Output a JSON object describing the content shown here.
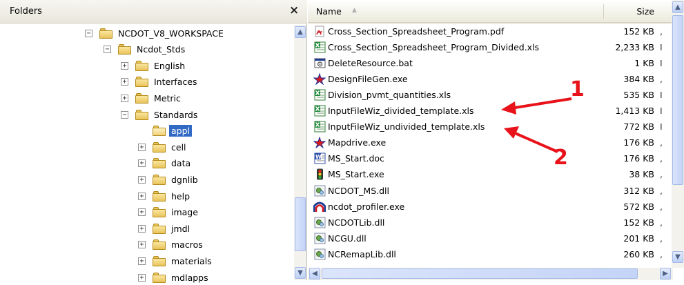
{
  "folders": {
    "title": "Folders",
    "close_glyph": "×",
    "tree": [
      {
        "label": "NCDOT_V8_WORKSPACE",
        "expander": "−",
        "icon": "folder-icon",
        "level": 0
      },
      {
        "label": "Ncdot_Stds",
        "expander": "−",
        "icon": "folder-icon",
        "level": 1
      },
      {
        "label": "English",
        "expander": "+",
        "icon": "folder-icon",
        "level": 2
      },
      {
        "label": "Interfaces",
        "expander": "+",
        "icon": "folder-icon",
        "level": 2
      },
      {
        "label": "Metric",
        "expander": "+",
        "icon": "folder-icon",
        "level": 2
      },
      {
        "label": "Standards",
        "expander": "−",
        "icon": "folder-icon",
        "level": 2
      },
      {
        "label": "appl",
        "expander": "",
        "icon": "folder-open-icon",
        "level": 3,
        "selected": true
      },
      {
        "label": "cell",
        "expander": "+",
        "icon": "folder-icon",
        "level": 3
      },
      {
        "label": "data",
        "expander": "+",
        "icon": "folder-icon",
        "level": 3
      },
      {
        "label": "dgnlib",
        "expander": "+",
        "icon": "folder-icon",
        "level": 3
      },
      {
        "label": "help",
        "expander": "+",
        "icon": "folder-icon",
        "level": 3
      },
      {
        "label": "image",
        "expander": "+",
        "icon": "folder-icon",
        "level": 3
      },
      {
        "label": "jmdl",
        "expander": "+",
        "icon": "folder-icon",
        "level": 3
      },
      {
        "label": "macros",
        "expander": "+",
        "icon": "folder-icon",
        "level": 3
      },
      {
        "label": "materials",
        "expander": "+",
        "icon": "folder-icon",
        "level": 3
      },
      {
        "label": "mdlapps",
        "expander": "+",
        "icon": "folder-icon",
        "level": 3
      }
    ]
  },
  "files": {
    "columns": {
      "name": "Name",
      "size": "Size"
    },
    "rows": [
      {
        "name": "Cross_Section_Spreadsheet_Program.pdf",
        "size": "152 KB",
        "trail": ",",
        "icon": "pdf-icon"
      },
      {
        "name": "Cross_Section_Spreadsheet_Program_Divided.xls",
        "size": "2,233 KB",
        "trail": "I",
        "icon": "excel-icon"
      },
      {
        "name": "DeleteResource.bat",
        "size": "1 KB",
        "trail": "I",
        "icon": "batch-icon"
      },
      {
        "name": "DesignFileGen.exe",
        "size": "384 KB",
        "trail": ",",
        "icon": "app-star-icon"
      },
      {
        "name": "Division_pvmt_quantities.xls",
        "size": "535 KB",
        "trail": "I",
        "icon": "excel-icon"
      },
      {
        "name": "InputFileWiz_divided_template.xls",
        "size": "1,413 KB",
        "trail": "I",
        "icon": "excel-icon"
      },
      {
        "name": "InputFileWiz_undivided_template.xls",
        "size": "772 KB",
        "trail": "I",
        "icon": "excel-icon"
      },
      {
        "name": "Mapdrive.exe",
        "size": "176 KB",
        "trail": ",",
        "icon": "app-star-icon"
      },
      {
        "name": "MS_Start.doc",
        "size": "176 KB",
        "trail": ",",
        "icon": "word-icon"
      },
      {
        "name": "MS_Start.exe",
        "size": "38 KB",
        "trail": ",",
        "icon": "traffic-light-icon"
      },
      {
        "name": "NCDOT_MS.dll",
        "size": "312 KB",
        "trail": ",",
        "icon": "dll-icon"
      },
      {
        "name": "ncdot_profiler.exe",
        "size": "572 KB",
        "trail": ",",
        "icon": "ncdot-logo-icon"
      },
      {
        "name": "NCDOTLib.dll",
        "size": "152 KB",
        "trail": ",",
        "icon": "dll-icon"
      },
      {
        "name": "NCGU.dll",
        "size": "201 KB",
        "trail": ",",
        "icon": "dll-icon"
      },
      {
        "name": "NCRemapLib.dll",
        "size": "260 KB",
        "trail": ",",
        "icon": "dll-icon"
      }
    ]
  },
  "annotations": [
    {
      "number": "1",
      "target": "InputFileWiz_divided_template.xls"
    },
    {
      "number": "2",
      "target": "InputFileWiz_undivided_template.xls"
    }
  ],
  "colors": {
    "selection": "#316ac5",
    "annotation": "#e8131a",
    "folder": "#e8c35a"
  }
}
